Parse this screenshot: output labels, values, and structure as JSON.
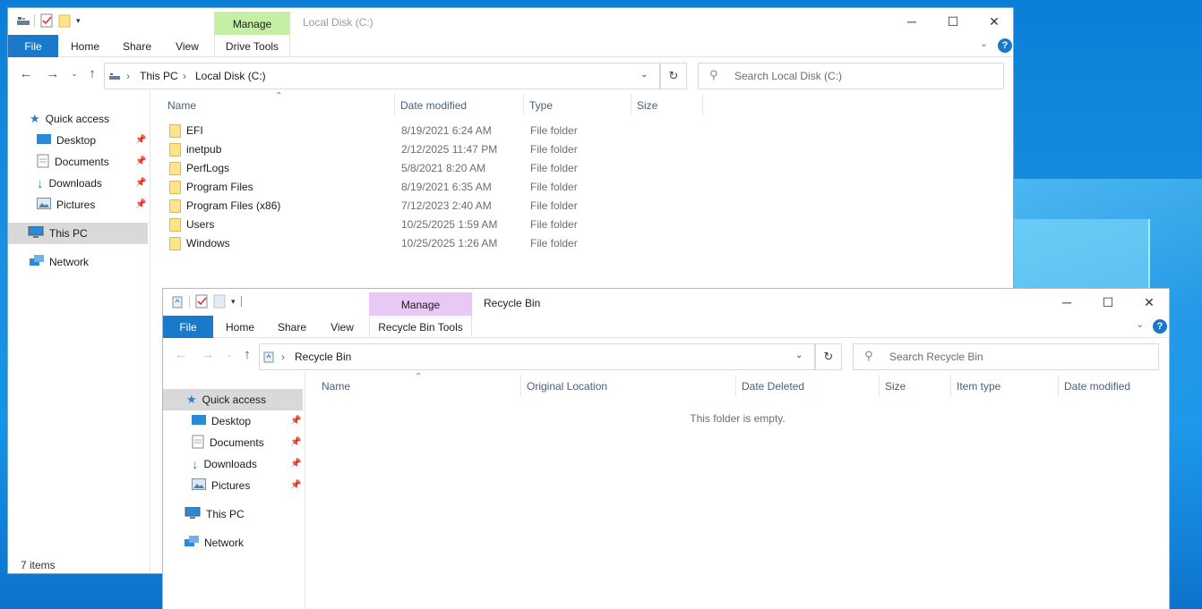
{
  "desktop": {
    "accent": "#1a8fe0"
  },
  "window_back": {
    "title": "Local Disk (C:)",
    "context_tab": {
      "group": "Manage",
      "tab": "Drive Tools",
      "color": "#c6efa6"
    },
    "tabs": [
      "File",
      "Home",
      "Share",
      "View"
    ],
    "breadcrumb": [
      "This PC",
      "Local Disk (C:)"
    ],
    "search_placeholder": "Search Local Disk (C:)",
    "nav": {
      "quick_access": "Quick access",
      "pinned": [
        "Desktop",
        "Documents",
        "Downloads",
        "Pictures"
      ],
      "this_pc": "This PC",
      "network": "Network"
    },
    "columns": [
      "Name",
      "Date modified",
      "Type",
      "Size"
    ],
    "files": [
      {
        "name": "EFI",
        "modified": "8/19/2021 6:24 AM",
        "type": "File folder"
      },
      {
        "name": "inetpub",
        "modified": "2/12/2025 11:47 PM",
        "type": "File folder"
      },
      {
        "name": "PerfLogs",
        "modified": "5/8/2021 8:20 AM",
        "type": "File folder"
      },
      {
        "name": "Program Files",
        "modified": "8/19/2021 6:35 AM",
        "type": "File folder"
      },
      {
        "name": "Program Files (x86)",
        "modified": "7/12/2023 2:40 AM",
        "type": "File folder"
      },
      {
        "name": "Users",
        "modified": "10/25/2025 1:59 AM",
        "type": "File folder"
      },
      {
        "name": "Windows",
        "modified": "10/25/2025 1:26 AM",
        "type": "File folder"
      }
    ],
    "status": "7 items"
  },
  "window_front": {
    "title": "Recycle Bin",
    "context_tab": {
      "group": "Manage",
      "tab": "Recycle Bin Tools",
      "color": "#e8c9f5"
    },
    "tabs": [
      "File",
      "Home",
      "Share",
      "View"
    ],
    "breadcrumb": [
      "Recycle Bin"
    ],
    "search_placeholder": "Search Recycle Bin",
    "nav": {
      "quick_access": "Quick access",
      "pinned": [
        "Desktop",
        "Documents",
        "Downloads",
        "Pictures"
      ],
      "this_pc": "This PC",
      "network": "Network"
    },
    "columns": [
      "Name",
      "Original Location",
      "Date Deleted",
      "Size",
      "Item type",
      "Date modified"
    ],
    "empty_message": "This folder is empty."
  },
  "window_controls": {
    "minimize": "─",
    "maximize": "☐",
    "close": "✕"
  },
  "help": "?"
}
